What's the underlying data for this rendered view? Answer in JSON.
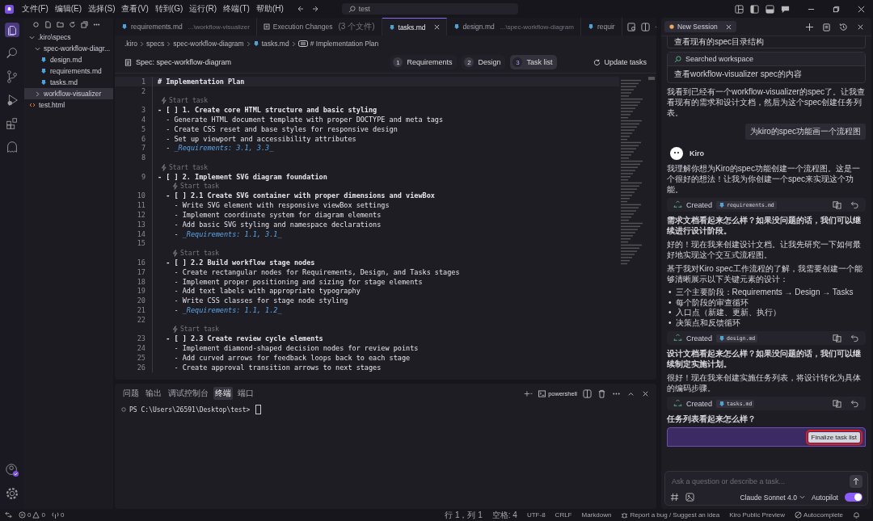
{
  "menu": [
    "文件(F)",
    "编辑(E)",
    "选择(S)",
    "查看(V)",
    "转到(G)",
    "运行(R)",
    "终端(T)",
    "帮助(H)"
  ],
  "search": {
    "value": "test"
  },
  "explorer": {
    "tree": [
      {
        "label": ".kiro\\specs",
        "kind": "folder",
        "expanded": true,
        "selected": false,
        "children": [
          {
            "label": "spec-workflow-diagr...",
            "kind": "folder",
            "expanded": true,
            "selected": false,
            "children": [
              {
                "label": "design.md",
                "kind": "md",
                "selected": false
              },
              {
                "label": "requirements.md",
                "kind": "md",
                "selected": false
              },
              {
                "label": "tasks.md",
                "kind": "md",
                "selected": false
              }
            ]
          },
          {
            "label": "workflow-visualizer",
            "kind": "folder",
            "expanded": false,
            "selected": true
          }
        ]
      },
      {
        "label": "test.html",
        "kind": "html",
        "selected": false
      }
    ]
  },
  "editor_tabs": [
    {
      "label": "requirements.md",
      "hint": "...\\workflow-visualizer",
      "kind": "md",
      "selected": false
    },
    {
      "label": "Execution Changes",
      "hint": "(3 个文件)",
      "kind": "diff",
      "selected": false
    },
    {
      "label": "tasks.md",
      "kind": "md",
      "selected": true
    },
    {
      "label": "design.md",
      "hint": "...\\spec-workflow-diagram",
      "kind": "md",
      "selected": false
    },
    {
      "label": "requir",
      "kind": "md",
      "selected": false
    }
  ],
  "breadcrumbs": [
    {
      "label": ".kiro",
      "kind": "text"
    },
    {
      "label": "specs",
      "kind": "text"
    },
    {
      "label": "spec-workflow-diagram",
      "kind": "text"
    },
    {
      "label": "tasks.md",
      "kind": "md"
    },
    {
      "label": "# Implementation Plan",
      "kind": "symbol"
    }
  ],
  "spec_bar": {
    "title": "Spec: spec-workflow-diagram",
    "steps": [
      {
        "num": "1",
        "label": "Requirements",
        "selected": false
      },
      {
        "num": "2",
        "label": "Design",
        "selected": false
      },
      {
        "num": "3",
        "label": "Task list",
        "selected": true
      }
    ],
    "action": "Update tasks"
  },
  "code": [
    {
      "kind": "heading",
      "num": "1",
      "text": "# Implementation Plan"
    },
    {
      "kind": "blank",
      "num": "2"
    },
    {
      "kind": "lens",
      "text": "Start task"
    },
    {
      "kind": "task",
      "num": "3",
      "text": "- [ ] 1. Create core HTML structure and basic styling"
    },
    {
      "kind": "line",
      "num": "4",
      "text": "  - Generate HTML document template with proper DOCTYPE and meta tags"
    },
    {
      "kind": "line",
      "num": "5",
      "text": "  - Create CSS reset and base styles for responsive design"
    },
    {
      "kind": "line",
      "num": "6",
      "text": "  - Set up viewport and accessibility attributes"
    },
    {
      "kind": "req",
      "num": "7",
      "pre": "  - ",
      "text": "_Requirements: 3.1, 3.3_"
    },
    {
      "kind": "blank",
      "num": "8"
    },
    {
      "kind": "lens",
      "text": "Start task"
    },
    {
      "kind": "task",
      "num": "9",
      "text": "- [ ] 2. Implement SVG diagram foundation"
    },
    {
      "kind": "sublens",
      "text": "Start task"
    },
    {
      "kind": "task",
      "num": "10",
      "text": "  - [ ] 2.1 Create SVG container with proper dimensions and viewBox"
    },
    {
      "kind": "line",
      "num": "11",
      "text": "    - Write SVG element with responsive viewBox settings"
    },
    {
      "kind": "line",
      "num": "12",
      "text": "    - Implement coordinate system for diagram elements"
    },
    {
      "kind": "line",
      "num": "13",
      "text": "    - Add basic SVG styling and namespace declarations"
    },
    {
      "kind": "req",
      "num": "14",
      "pre": "    - ",
      "text": "_Requirements: 1.1, 3.1_"
    },
    {
      "kind": "blank",
      "num": "15"
    },
    {
      "kind": "sublens",
      "text": "Start task"
    },
    {
      "kind": "task",
      "num": "16",
      "text": "  - [ ] 2.2 Build workflow stage nodes"
    },
    {
      "kind": "line",
      "num": "17",
      "text": "    - Create rectangular nodes for Requirements, Design, and Tasks stages"
    },
    {
      "kind": "line",
      "num": "18",
      "text": "    - Implement proper positioning and sizing for stage elements"
    },
    {
      "kind": "line",
      "num": "19",
      "text": "    - Add text labels with appropriate typography"
    },
    {
      "kind": "line",
      "num": "20",
      "text": "    - Write CSS classes for stage node styling"
    },
    {
      "kind": "req",
      "num": "21",
      "pre": "    - ",
      "text": "_Requirements: 1.1, 1.2_"
    },
    {
      "kind": "blank",
      "num": "22"
    },
    {
      "kind": "sublens",
      "text": "Start task"
    },
    {
      "kind": "task",
      "num": "23",
      "text": "  - [ ] 2.3 Create review cycle elements"
    },
    {
      "kind": "line",
      "num": "24",
      "text": "    - Implement diamond-shaped decision nodes for review points"
    },
    {
      "kind": "line",
      "num": "25",
      "text": "    - Add curved arrows for feedback loops back to each stage"
    },
    {
      "kind": "line",
      "num": "26",
      "text": "    - Create approval transition arrows to next stages"
    }
  ],
  "panel": {
    "tabs": [
      {
        "label": "问题",
        "selected": false
      },
      {
        "label": "输出",
        "selected": false
      },
      {
        "label": "调试控制台",
        "selected": false
      },
      {
        "label": "终端",
        "selected": true
      },
      {
        "label": "端口",
        "selected": false
      }
    ],
    "shell": "powershell",
    "prompt": "PS C:\\Users\\26591\\Desktop\\test>"
  },
  "chat": {
    "tab": "New Session",
    "items": [
      {
        "kind": "tool-body",
        "body": "查看现有的spec目录结构"
      },
      {
        "kind": "tool",
        "title": "Searched workspace",
        "body": "查看workflow-visualizer spec的内容"
      },
      {
        "kind": "text",
        "text": "我看到已经有一个workflow-visualizer的spec了。让我查看现有的需求和设计文档，然后为这个spec创建任务列表。"
      },
      {
        "kind": "user",
        "text": "为kiro的spec功能画一个流程图"
      },
      {
        "kind": "agent",
        "text": "Kiro"
      },
      {
        "kind": "text",
        "text": "我理解你想为Kiro的spec功能创建一个流程图。这是一个很好的想法！让我为你创建一个spec来实现这个功能。"
      },
      {
        "kind": "created",
        "label": "Created",
        "file": "requirements.md"
      },
      {
        "kind": "bold",
        "text": "需求文档看起来怎么样？如果没问题的话，我们可以继续进行设计阶段。"
      },
      {
        "kind": "text",
        "text": "好的！现在我来创建设计文档。让我先研究一下如何最好地实现这个交互式流程图。"
      },
      {
        "kind": "text",
        "text": "基于我对Kiro spec工作流程的了解，我需要创建一个能够清晰展示以下关键元素的设计："
      },
      {
        "kind": "bullets",
        "items": [
          {
            "marker": "•",
            "text": "三个主要阶段：Requirements → Design → Tasks"
          },
          {
            "marker": "•",
            "text": "每个阶段的审查循环"
          },
          {
            "marker": "•",
            "text": "入口点（新建、更新、执行）"
          },
          {
            "marker": "•",
            "text": "决策点和反馈循环"
          }
        ]
      },
      {
        "kind": "created",
        "label": "Created",
        "file": "design.md"
      },
      {
        "kind": "bold",
        "text": "设计文档看起来怎么样？如果没问题的话，我们可以继续制定实施计划。"
      },
      {
        "kind": "text",
        "text": "很好！现在我来创建实施任务列表，将设计转化为具体的编码步骤。"
      },
      {
        "kind": "created",
        "label": "Created",
        "file": "tasks.md"
      },
      {
        "kind": "bold",
        "text": "任务列表看起来怎么样？"
      },
      {
        "kind": "action",
        "button": "Finalize task list"
      }
    ],
    "input": {
      "placeholder": "Ask a question or describe a task...",
      "model": "Claude Sonnet 4.0",
      "autopilot_label": "Autopilot",
      "autopilot": true
    }
  },
  "status_bar": {
    "errors": "0",
    "warnings": "0",
    "ports": "0",
    "right": [
      {
        "kind": "text",
        "label": "行 1，列 1"
      },
      {
        "kind": "text",
        "label": "空格: 4"
      },
      {
        "kind": "text",
        "label": "UTF-8"
      },
      {
        "kind": "text",
        "label": "CRLF"
      },
      {
        "kind": "text",
        "label": "Markdown"
      },
      {
        "kind": "bug",
        "label": "Report a bug / Suggest an idea"
      },
      {
        "kind": "text",
        "label": "Kiro Public Preview"
      },
      {
        "kind": "off",
        "label": "Autocomplete"
      }
    ]
  }
}
